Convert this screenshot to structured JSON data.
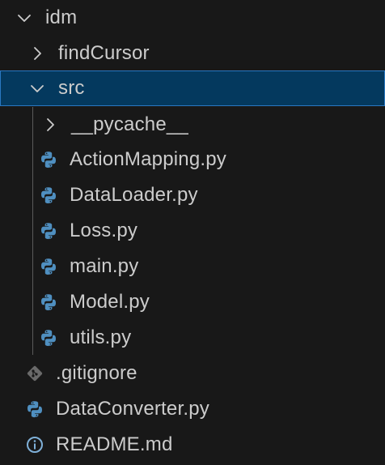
{
  "explorer": {
    "root": {
      "label": "idm",
      "expanded": true
    },
    "items": [
      {
        "label": "findCursor",
        "type": "folder",
        "expanded": false
      },
      {
        "label": "src",
        "type": "folder",
        "expanded": true,
        "selected": true
      },
      {
        "label": "__pycache__",
        "type": "folder",
        "expanded": false
      },
      {
        "label": "ActionMapping.py",
        "type": "file",
        "icon": "python-icon"
      },
      {
        "label": "DataLoader.py",
        "type": "file",
        "icon": "python-icon"
      },
      {
        "label": "Loss.py",
        "type": "file",
        "icon": "python-icon"
      },
      {
        "label": "main.py",
        "type": "file",
        "icon": "python-icon"
      },
      {
        "label": "Model.py",
        "type": "file",
        "icon": "python-icon"
      },
      {
        "label": "utils.py",
        "type": "file",
        "icon": "python-icon"
      },
      {
        "label": ".gitignore",
        "type": "file",
        "icon": "git-icon"
      },
      {
        "label": "DataConverter.py",
        "type": "file",
        "icon": "python-icon"
      },
      {
        "label": "README.md",
        "type": "file",
        "icon": "info-icon"
      }
    ]
  },
  "colors": {
    "background": "#181818",
    "text": "#cccccc",
    "selection_bg": "#04395e",
    "selection_border": "#2a78c2",
    "python_icon": "#4f8fc0",
    "git_icon": "#6a6a6a",
    "info_icon": "#7fb0d8"
  }
}
